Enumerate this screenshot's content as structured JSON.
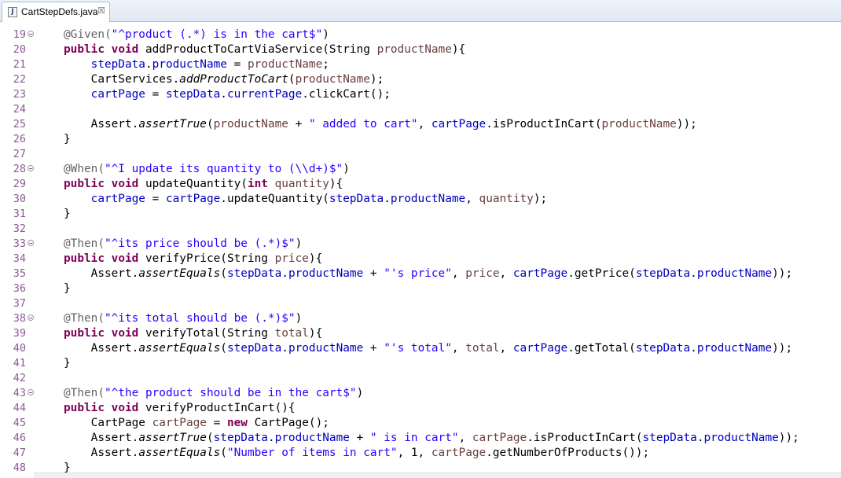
{
  "tab": {
    "title": "CartStepDefs.java",
    "icon": "java-file-icon",
    "close_glyph": "☒"
  },
  "lines": [
    {
      "n": "19",
      "fold": true,
      "tokens": [
        {
          "c": "a",
          "t": "@Given("
        },
        {
          "c": "s",
          "t": "\"^product (.*) is in the cart$\""
        },
        {
          "c": "",
          "t": ")"
        }
      ]
    },
    {
      "n": "20",
      "tokens": [
        {
          "c": "k",
          "t": "public"
        },
        {
          "c": "",
          "t": " "
        },
        {
          "c": "k",
          "t": "void"
        },
        {
          "c": "",
          "t": " addProductToCartViaService(String "
        },
        {
          "c": "p",
          "t": "productName"
        },
        {
          "c": "",
          "t": "){"
        }
      ]
    },
    {
      "n": "21",
      "tokens": [
        {
          "c": "",
          "t": "    "
        },
        {
          "c": "f",
          "t": "stepData"
        },
        {
          "c": "",
          "t": "."
        },
        {
          "c": "f",
          "t": "productName"
        },
        {
          "c": "",
          "t": " = "
        },
        {
          "c": "p",
          "t": "productName"
        },
        {
          "c": "",
          "t": ";"
        }
      ]
    },
    {
      "n": "22",
      "tokens": [
        {
          "c": "",
          "t": "    CartServices."
        },
        {
          "c": "i",
          "t": "addProductToCart"
        },
        {
          "c": "",
          "t": "("
        },
        {
          "c": "p",
          "t": "productName"
        },
        {
          "c": "",
          "t": ");"
        }
      ]
    },
    {
      "n": "23",
      "tokens": [
        {
          "c": "",
          "t": "    "
        },
        {
          "c": "f",
          "t": "cartPage"
        },
        {
          "c": "",
          "t": " = "
        },
        {
          "c": "f",
          "t": "stepData"
        },
        {
          "c": "",
          "t": "."
        },
        {
          "c": "f",
          "t": "currentPage"
        },
        {
          "c": "",
          "t": ".clickCart();"
        }
      ]
    },
    {
      "n": "24",
      "tokens": []
    },
    {
      "n": "25",
      "tokens": [
        {
          "c": "",
          "t": "    Assert."
        },
        {
          "c": "i",
          "t": "assertTrue"
        },
        {
          "c": "",
          "t": "("
        },
        {
          "c": "p",
          "t": "productName"
        },
        {
          "c": "",
          "t": " + "
        },
        {
          "c": "s",
          "t": "\" added to cart\""
        },
        {
          "c": "",
          "t": ", "
        },
        {
          "c": "f",
          "t": "cartPage"
        },
        {
          "c": "",
          "t": ".isProductInCart("
        },
        {
          "c": "p",
          "t": "productName"
        },
        {
          "c": "",
          "t": "));"
        }
      ]
    },
    {
      "n": "26",
      "tokens": [
        {
          "c": "",
          "t": "}"
        }
      ]
    },
    {
      "n": "27",
      "tokens": []
    },
    {
      "n": "28",
      "fold": true,
      "tokens": [
        {
          "c": "a",
          "t": "@When("
        },
        {
          "c": "s",
          "t": "\"^I update its quantity to (\\\\d+)$\""
        },
        {
          "c": "",
          "t": ")"
        }
      ]
    },
    {
      "n": "29",
      "tokens": [
        {
          "c": "k",
          "t": "public"
        },
        {
          "c": "",
          "t": " "
        },
        {
          "c": "k",
          "t": "void"
        },
        {
          "c": "",
          "t": " updateQuantity("
        },
        {
          "c": "k",
          "t": "int"
        },
        {
          "c": "",
          "t": " "
        },
        {
          "c": "p",
          "t": "quantity"
        },
        {
          "c": "",
          "t": "){"
        }
      ]
    },
    {
      "n": "30",
      "tokens": [
        {
          "c": "",
          "t": "    "
        },
        {
          "c": "f",
          "t": "cartPage"
        },
        {
          "c": "",
          "t": " = "
        },
        {
          "c": "f",
          "t": "cartPage"
        },
        {
          "c": "",
          "t": ".updateQuantity("
        },
        {
          "c": "f",
          "t": "stepData"
        },
        {
          "c": "",
          "t": "."
        },
        {
          "c": "f",
          "t": "productName"
        },
        {
          "c": "",
          "t": ", "
        },
        {
          "c": "p",
          "t": "quantity"
        },
        {
          "c": "",
          "t": ");"
        }
      ]
    },
    {
      "n": "31",
      "tokens": [
        {
          "c": "",
          "t": "}"
        }
      ]
    },
    {
      "n": "32",
      "tokens": []
    },
    {
      "n": "33",
      "fold": true,
      "tokens": [
        {
          "c": "a",
          "t": "@Then("
        },
        {
          "c": "s",
          "t": "\"^its price should be (.*)$\""
        },
        {
          "c": "",
          "t": ")"
        }
      ]
    },
    {
      "n": "34",
      "tokens": [
        {
          "c": "k",
          "t": "public"
        },
        {
          "c": "",
          "t": " "
        },
        {
          "c": "k",
          "t": "void"
        },
        {
          "c": "",
          "t": " verifyPrice(String "
        },
        {
          "c": "p",
          "t": "price"
        },
        {
          "c": "",
          "t": "){"
        }
      ]
    },
    {
      "n": "35",
      "tokens": [
        {
          "c": "",
          "t": "    Assert."
        },
        {
          "c": "i",
          "t": "assertEquals"
        },
        {
          "c": "",
          "t": "("
        },
        {
          "c": "f",
          "t": "stepData"
        },
        {
          "c": "",
          "t": "."
        },
        {
          "c": "f",
          "t": "productName"
        },
        {
          "c": "",
          "t": " + "
        },
        {
          "c": "s",
          "t": "\"'s price\""
        },
        {
          "c": "",
          "t": ", "
        },
        {
          "c": "p",
          "t": "price"
        },
        {
          "c": "",
          "t": ", "
        },
        {
          "c": "f",
          "t": "cartPage"
        },
        {
          "c": "",
          "t": ".getPrice("
        },
        {
          "c": "f",
          "t": "stepData"
        },
        {
          "c": "",
          "t": "."
        },
        {
          "c": "f",
          "t": "productName"
        },
        {
          "c": "",
          "t": "));"
        }
      ]
    },
    {
      "n": "36",
      "tokens": [
        {
          "c": "",
          "t": "}"
        }
      ]
    },
    {
      "n": "37",
      "tokens": []
    },
    {
      "n": "38",
      "fold": true,
      "tokens": [
        {
          "c": "a",
          "t": "@Then("
        },
        {
          "c": "s",
          "t": "\"^its total should be (.*)$\""
        },
        {
          "c": "",
          "t": ")"
        }
      ]
    },
    {
      "n": "39",
      "tokens": [
        {
          "c": "k",
          "t": "public"
        },
        {
          "c": "",
          "t": " "
        },
        {
          "c": "k",
          "t": "void"
        },
        {
          "c": "",
          "t": " verifyTotal(String "
        },
        {
          "c": "p",
          "t": "total"
        },
        {
          "c": "",
          "t": "){"
        }
      ]
    },
    {
      "n": "40",
      "tokens": [
        {
          "c": "",
          "t": "    Assert."
        },
        {
          "c": "i",
          "t": "assertEquals"
        },
        {
          "c": "",
          "t": "("
        },
        {
          "c": "f",
          "t": "stepData"
        },
        {
          "c": "",
          "t": "."
        },
        {
          "c": "f",
          "t": "productName"
        },
        {
          "c": "",
          "t": " + "
        },
        {
          "c": "s",
          "t": "\"'s total\""
        },
        {
          "c": "",
          "t": ", "
        },
        {
          "c": "p",
          "t": "total"
        },
        {
          "c": "",
          "t": ", "
        },
        {
          "c": "f",
          "t": "cartPage"
        },
        {
          "c": "",
          "t": ".getTotal("
        },
        {
          "c": "f",
          "t": "stepData"
        },
        {
          "c": "",
          "t": "."
        },
        {
          "c": "f",
          "t": "productName"
        },
        {
          "c": "",
          "t": "));"
        }
      ]
    },
    {
      "n": "41",
      "tokens": [
        {
          "c": "",
          "t": "}"
        }
      ]
    },
    {
      "n": "42",
      "tokens": []
    },
    {
      "n": "43",
      "fold": true,
      "tokens": [
        {
          "c": "a",
          "t": "@Then("
        },
        {
          "c": "s",
          "t": "\"^the product should be in the cart$\""
        },
        {
          "c": "",
          "t": ")"
        }
      ]
    },
    {
      "n": "44",
      "tokens": [
        {
          "c": "k",
          "t": "public"
        },
        {
          "c": "",
          "t": " "
        },
        {
          "c": "k",
          "t": "void"
        },
        {
          "c": "",
          "t": " verifyProductInCart(){"
        }
      ]
    },
    {
      "n": "45",
      "tokens": [
        {
          "c": "",
          "t": "    CartPage "
        },
        {
          "c": "p",
          "t": "cartPage"
        },
        {
          "c": "",
          "t": " = "
        },
        {
          "c": "k",
          "t": "new"
        },
        {
          "c": "",
          "t": " CartPage();"
        }
      ]
    },
    {
      "n": "46",
      "tokens": [
        {
          "c": "",
          "t": "    Assert."
        },
        {
          "c": "i",
          "t": "assertTrue"
        },
        {
          "c": "",
          "t": "("
        },
        {
          "c": "f",
          "t": "stepData"
        },
        {
          "c": "",
          "t": "."
        },
        {
          "c": "f",
          "t": "productName"
        },
        {
          "c": "",
          "t": " + "
        },
        {
          "c": "s",
          "t": "\" is in cart\""
        },
        {
          "c": "",
          "t": ", "
        },
        {
          "c": "p",
          "t": "cartPage"
        },
        {
          "c": "",
          "t": ".isProductInCart("
        },
        {
          "c": "f",
          "t": "stepData"
        },
        {
          "c": "",
          "t": "."
        },
        {
          "c": "f",
          "t": "productName"
        },
        {
          "c": "",
          "t": "));"
        }
      ]
    },
    {
      "n": "47",
      "tokens": [
        {
          "c": "",
          "t": "    Assert."
        },
        {
          "c": "i",
          "t": "assertEquals"
        },
        {
          "c": "",
          "t": "("
        },
        {
          "c": "s",
          "t": "\"Number of items in cart\""
        },
        {
          "c": "",
          "t": ", 1, "
        },
        {
          "c": "p",
          "t": "cartPage"
        },
        {
          "c": "",
          "t": ".getNumberOfProducts());"
        }
      ]
    },
    {
      "n": "48",
      "tokens": [
        {
          "c": "",
          "t": "}"
        }
      ]
    }
  ]
}
